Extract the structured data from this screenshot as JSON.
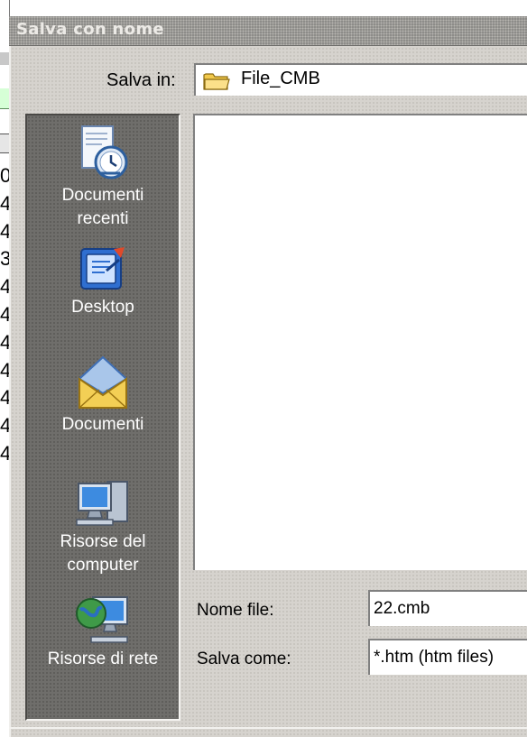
{
  "background_app": {
    "digits": [
      "0",
      "4",
      "4",
      "3",
      "4",
      "4",
      "4",
      "4",
      "4",
      "4",
      "4"
    ]
  },
  "dialog": {
    "title": "Salva con nome",
    "save_in_label": "Salva in:",
    "save_in_value": "File_CMB",
    "places": [
      {
        "label": "Documenti\nrecenti",
        "icon": "recent-documents-icon"
      },
      {
        "label": "Desktop",
        "icon": "desktop-icon"
      },
      {
        "label": "Documenti",
        "icon": "my-documents-icon"
      },
      {
        "label": "Risorse del\ncomputer",
        "icon": "my-computer-icon"
      },
      {
        "label": "Risorse di rete",
        "icon": "network-places-icon"
      }
    ],
    "filename_label": "Nome file:",
    "filename_value": "22.cmb",
    "filetype_label": "Salva come:",
    "filetype_value": "*.htm (htm files)"
  },
  "colors": {
    "dialog_face": "#d6d3ce",
    "places_bar": "#6f6e6b",
    "title_bar": "#8d8c89"
  }
}
